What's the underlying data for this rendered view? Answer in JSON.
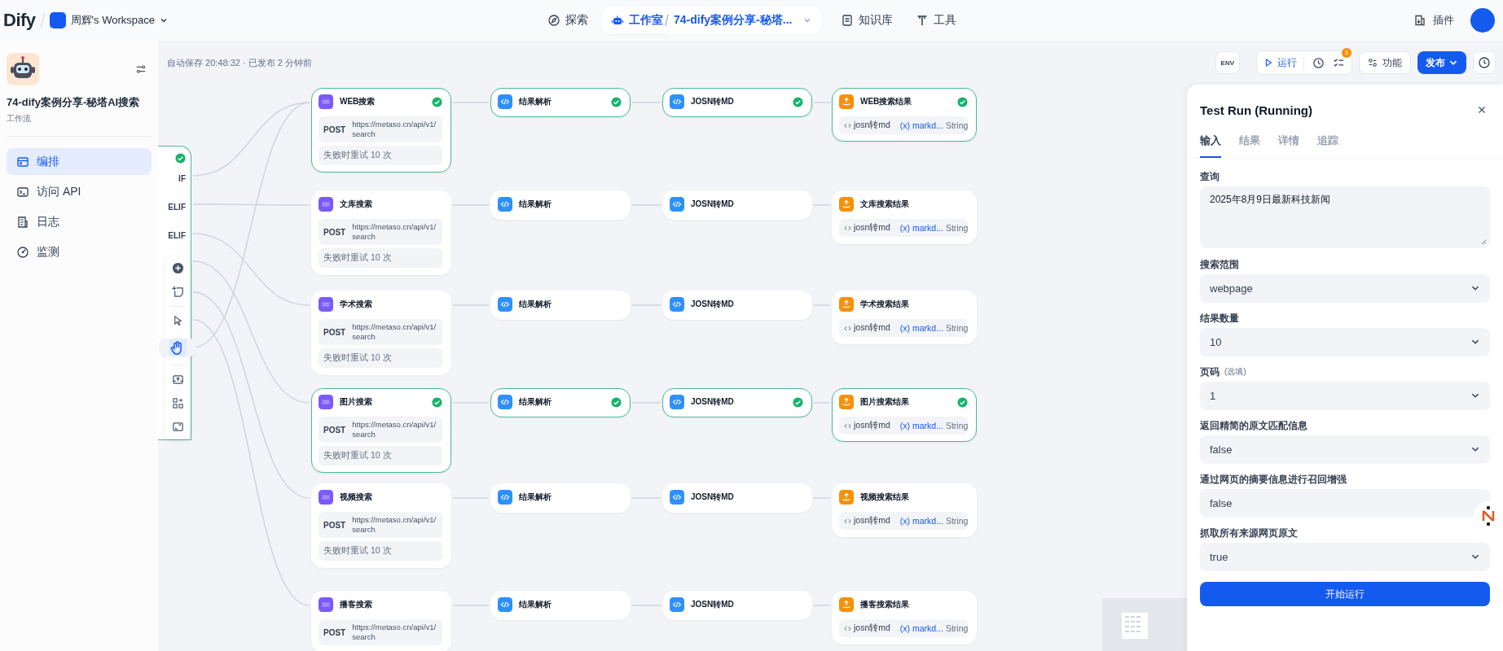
{
  "topbar": {
    "logo": "Dify",
    "workspace": "周辉's Workspace",
    "nav": [
      {
        "label": "探索",
        "selected": false,
        "kind": "explore"
      },
      {
        "label": "工作室",
        "selected": true,
        "kind": "studio"
      },
      {
        "label": "知识库",
        "selected": false,
        "kind": "knowledge"
      },
      {
        "label": "工具",
        "selected": false,
        "kind": "tools"
      }
    ],
    "app_tab": "74-dify案例分享-秘塔...",
    "plugins": "插件"
  },
  "sidebar": {
    "app_name": "74-dify案例分享-秘塔AI搜索",
    "app_type": "工作流",
    "items": [
      {
        "label": "编排",
        "selected": true,
        "kind": "orchestrate"
      },
      {
        "label": "访问 API",
        "selected": false,
        "kind": "api"
      },
      {
        "label": "日志",
        "selected": false,
        "kind": "logs"
      },
      {
        "label": "监测",
        "selected": false,
        "kind": "monitor"
      }
    ]
  },
  "canvas": {
    "save_status": "自动保存 20:48:32 · 已发布 2 分钟前",
    "toolbar": {
      "env": "ENV",
      "run": "运行",
      "checklist_badge": "1",
      "features": "功能",
      "publish": "发布"
    },
    "if_node": {
      "succeeded": true,
      "branches": [
        "IF",
        "ELIF",
        "ELIF"
      ]
    },
    "rows": [
      {
        "nodes": [
          {
            "kind": "http",
            "title": "WEB搜索",
            "method": "POST",
            "url": "https://metaso.cn/api/v1/search",
            "retry": "失败时重试 10 次",
            "succeeded": true
          },
          {
            "kind": "code",
            "title": "结果解析",
            "succeeded": true
          },
          {
            "kind": "code",
            "title": "JOSN转MD",
            "succeeded": true
          },
          {
            "kind": "end",
            "title": "WEB搜索结果",
            "source": "josn转md",
            "variable": "(x) markd...",
            "type": "String",
            "succeeded": true
          }
        ]
      },
      {
        "nodes": [
          {
            "kind": "http",
            "title": "文库搜索",
            "method": "POST",
            "url": "https://metaso.cn/api/v1/search",
            "retry": "失败时重试 10 次",
            "succeeded": false
          },
          {
            "kind": "code",
            "title": "结果解析",
            "succeeded": false
          },
          {
            "kind": "code",
            "title": "JOSN转MD",
            "succeeded": false
          },
          {
            "kind": "end",
            "title": "文库搜索结果",
            "source": "josn转md",
            "variable": "(x) markd...",
            "type": "String",
            "succeeded": false
          }
        ]
      },
      {
        "nodes": [
          {
            "kind": "http",
            "title": "学术搜索",
            "method": "POST",
            "url": "https://metaso.cn/api/v1/search",
            "retry": "失败时重试 10 次",
            "succeeded": false
          },
          {
            "kind": "code",
            "title": "结果解析",
            "succeeded": false
          },
          {
            "kind": "code",
            "title": "JOSN转MD",
            "succeeded": false
          },
          {
            "kind": "end",
            "title": "学术搜索结果",
            "source": "josn转md",
            "variable": "(x) markd...",
            "type": "String",
            "succeeded": false
          }
        ]
      },
      {
        "nodes": [
          {
            "kind": "http",
            "title": "图片搜索",
            "method": "POST",
            "url": "https://metaso.cn/api/v1/search",
            "retry": "失败时重试 10 次",
            "succeeded": true
          },
          {
            "kind": "code",
            "title": "结果解析",
            "succeeded": true
          },
          {
            "kind": "code",
            "title": "JOSN转MD",
            "succeeded": true
          },
          {
            "kind": "end",
            "title": "图片搜索结果",
            "source": "josn转md",
            "variable": "(x) markd...",
            "type": "String",
            "succeeded": true
          }
        ]
      },
      {
        "nodes": [
          {
            "kind": "http",
            "title": "视频搜索",
            "method": "POST",
            "url": "https://metaso.cn/api/v1/search",
            "retry": "失败时重试 10 次",
            "succeeded": false
          },
          {
            "kind": "code",
            "title": "结果解析",
            "succeeded": false
          },
          {
            "kind": "code",
            "title": "JOSN转MD",
            "succeeded": false
          },
          {
            "kind": "end",
            "title": "视频搜索结果",
            "source": "josn转md",
            "variable": "(x) markd...",
            "type": "String",
            "succeeded": false
          }
        ]
      },
      {
        "nodes": [
          {
            "kind": "http",
            "title": "播客搜索",
            "method": "POST",
            "url": "https://metaso.cn/api/v1/search",
            "succeeded": false
          },
          {
            "kind": "code",
            "title": "结果解析",
            "succeeded": false
          },
          {
            "kind": "code",
            "title": "JOSN转MD",
            "succeeded": false
          },
          {
            "kind": "end",
            "title": "播客搜索结果",
            "source": "josn转md",
            "variable": "(x) markd...",
            "type": "String",
            "succeeded": false
          }
        ]
      }
    ]
  },
  "panel": {
    "title": "Test Run (Running)",
    "tabs": [
      {
        "label": "输入",
        "selected": true
      },
      {
        "label": "结果",
        "selected": false
      },
      {
        "label": "详情",
        "selected": false
      },
      {
        "label": "追踪",
        "selected": false
      }
    ],
    "fields": [
      {
        "kind": "textarea",
        "label": "查询",
        "value": "2025年8月9日最新科技新闻"
      },
      {
        "kind": "select",
        "label": "搜索范围",
        "value": "webpage"
      },
      {
        "kind": "select",
        "label": "结果数量",
        "value": "10"
      },
      {
        "kind": "select",
        "label": "页码",
        "hint": "(选填)",
        "value": "1"
      },
      {
        "kind": "select",
        "label": "返回精简的原文匹配信息",
        "value": "false"
      },
      {
        "kind": "input",
        "label": "通过网页的摘要信息进行召回增强",
        "value": "false"
      },
      {
        "kind": "select",
        "label": "抓取所有来源网页原文",
        "value": "true"
      }
    ],
    "run_button": "开始运行"
  }
}
